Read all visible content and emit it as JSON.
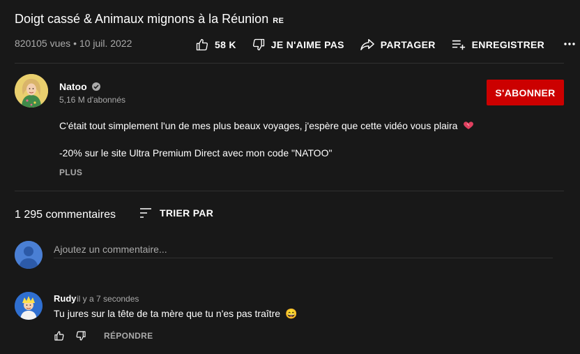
{
  "video": {
    "title": "Doigt cassé & Animaux mignons à la Réunion",
    "badge": "RE",
    "views": "820105 vues",
    "separator": "•",
    "date": "10 juil. 2022"
  },
  "actions": {
    "like_count": "58 K",
    "dislike_label": "JE N'AIME PAS",
    "share_label": "PARTAGER",
    "save_label": "ENREGISTRER"
  },
  "channel": {
    "name": "Natoo",
    "subscribers": "5,16 M d'abonnés",
    "subscribe_label": "S'ABONNER"
  },
  "description": {
    "line1": "C'était tout simplement l'un de mes plus beaux voyages, j'espère que cette vidéo vous plaira",
    "line2": "-20% sur le site Ultra Premium Direct avec mon code \"NATOO\"",
    "more_label": "PLUS"
  },
  "comments": {
    "count": "1 295 commentaires",
    "sort_label": "TRIER PAR",
    "placeholder": "Ajoutez un commentaire...",
    "items": [
      {
        "author": "Rudy",
        "time": "il y a 7 secondes",
        "text": "Tu jures sur la tête de ta mère que tu n'es pas traître",
        "emoji": "😄",
        "reply_label": "RÉPONDRE"
      }
    ]
  },
  "colors": {
    "background": "#181818",
    "subscribe": "#cc0000",
    "secondary_text": "#aaaaaa",
    "divider": "#303030"
  },
  "icons": [
    "thumb-up-icon",
    "thumb-down-icon",
    "share-icon",
    "playlist-add-icon",
    "more-icon",
    "verified-icon",
    "sort-icon",
    "heart-icon"
  ]
}
